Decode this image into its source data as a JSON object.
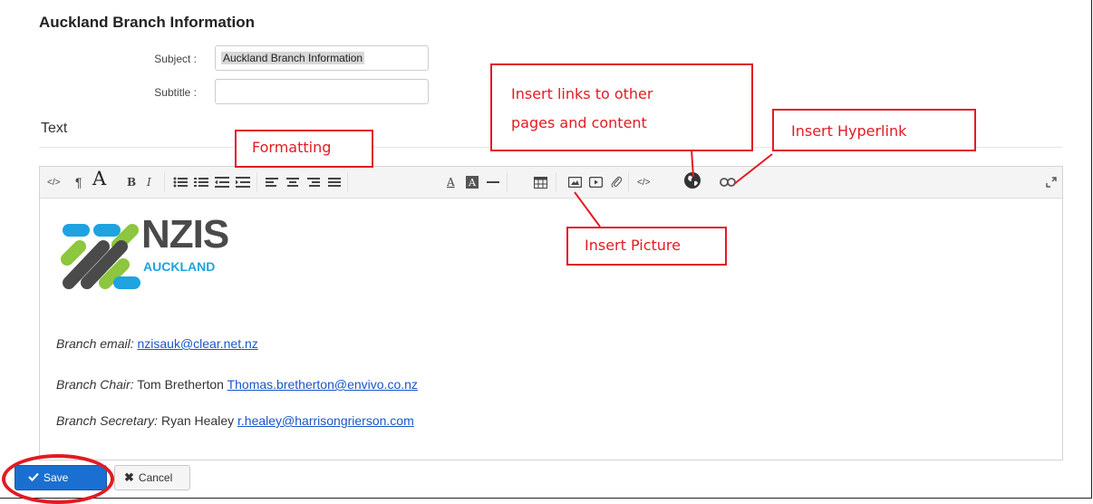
{
  "page": {
    "title": "Auckland Branch Information"
  },
  "form": {
    "subject_label": "Subject :",
    "subject_value": "Auckland Branch Information",
    "subtitle_label": "Subtitle :",
    "subtitle_value": ""
  },
  "editor": {
    "section_heading": "Text",
    "toolbar": {
      "buttons": [
        "html-source",
        "paragraph",
        "font-size",
        "bold",
        "italic",
        "unordered-list",
        "ordered-list",
        "outdent",
        "indent",
        "align-left",
        "align-center",
        "align-right",
        "justify",
        "font-color",
        "back-color",
        "horizontal-rule",
        "table",
        "image",
        "video",
        "file",
        "code",
        "insert-link-globe",
        "hyperlink",
        "fullscreen"
      ],
      "html_label": "</>",
      "paragraph_label": "¶",
      "font_size_label": "A",
      "bold_label": "B",
      "italic_label": "I",
      "font_color_label": "A",
      "back_color_label": "A",
      "code_label": "</>"
    },
    "content": {
      "logo_main": "NZIS",
      "logo_sub": "AUCKLAND",
      "logo_colors": {
        "blue": "#1fa3e0",
        "green": "#8dc63f",
        "dark": "#4a4a4a"
      },
      "email_label": "Branch email:",
      "email_value": "nzisauk@clear.net.nz",
      "chair_label": "Branch Chair:",
      "chair_name": "Tom Bretherton",
      "chair_email": "Thomas.bretherton@envivo.co.nz",
      "secretary_label": "Branch Secretary:",
      "secretary_name": "Ryan Healey",
      "secretary_email": "r.healey@harrisongrierson.com"
    }
  },
  "actions": {
    "save_label": "Save",
    "cancel_label": "Cancel"
  },
  "annotations": {
    "formatting": "Formatting",
    "insert_links_line1": "Insert links to other",
    "insert_links_line2": "pages and content",
    "insert_hyperlink": "Insert Hyperlink",
    "insert_picture": "Insert Picture",
    "color": "#e21b23"
  },
  "colors": {
    "accent": "#1a6fd1",
    "link": "#1a55c8"
  }
}
